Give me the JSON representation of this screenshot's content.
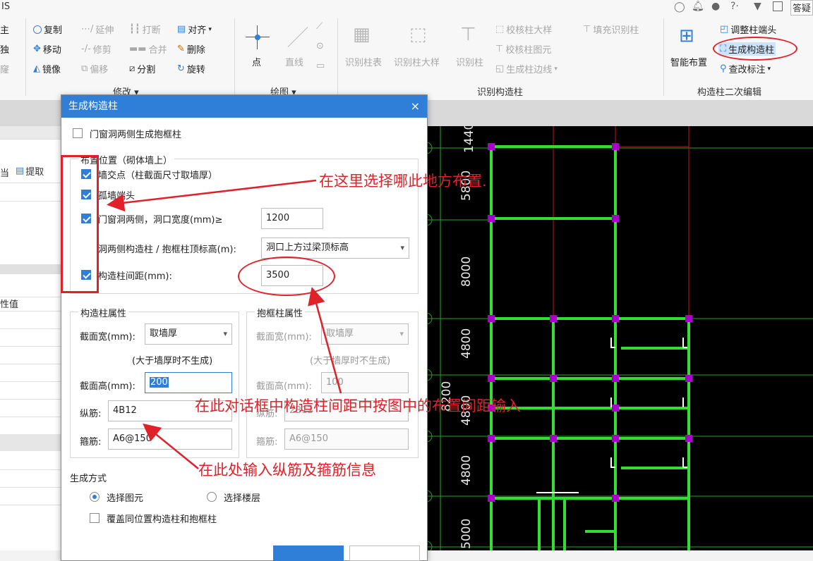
{
  "titlebar": {
    "left_fragment": "IS",
    "right_fragment": "答疑"
  },
  "ribbon": {
    "left_cut": [
      "主",
      "独",
      "窿"
    ],
    "modify": {
      "copy": "复制",
      "extend": "延伸",
      "break": "打断",
      "align": "对齐",
      "move": "移动",
      "trim": "修剪",
      "merge": "合并",
      "delete": "删除",
      "mirror": "镜像",
      "offset": "偏移",
      "split": "分割",
      "rotate": "旋转",
      "group": "修改 ▾"
    },
    "draw": {
      "point": "点",
      "line": "直线",
      "group": "绘图 ▾"
    },
    "recognize": {
      "col_table": "识别柱表",
      "col_sample": "识别柱大样",
      "col": "识别柱",
      "check_sample": "校核柱大样",
      "check_plan": "校核柱图元",
      "gen_edge": "生成柱边线",
      "fill_recognize": "填充识别柱",
      "group": "识别构造柱"
    },
    "edit2": {
      "smart_place": "智能布置",
      "adjust_end": "调整柱端头",
      "gen_construct": "生成构造柱",
      "modify_label": "查改标注",
      "group": "构造柱二次编辑"
    }
  },
  "leftpanel": {
    "extract": "提取",
    "cut": "当",
    "prop_value": "性值"
  },
  "dialog": {
    "title": "生成构造柱",
    "close": "×",
    "opening_frame": "门窗洞两侧生成抱框柱",
    "placement_legend": "布置位置（砌体墙上）",
    "opt_wall_cross": "墙交点（柱截面尺寸取墙厚）",
    "opt_isolated_end": "孤墙端头",
    "opt_opening_sides": "门窗洞两侧，洞口宽度(mm)≥",
    "opening_width": "1200",
    "top_elev_label": "洞两侧构造柱 / 抱框柱顶标高(m):",
    "top_elev_value": "洞口上方过梁顶标高",
    "opt_spacing": "构造柱间距(mm):",
    "spacing_value": "3500",
    "col_props": {
      "legend": "构造柱属性",
      "width_label": "截面宽(mm):",
      "width_value": "取墙厚",
      "note": "(大于墙厚时不生成)",
      "height_label": "截面高(mm):",
      "height_value": "200",
      "long_bar_label": "纵筋:",
      "long_bar_value": "4B12",
      "stirrup_label": "箍筋:",
      "stirrup_value": "A6@150"
    },
    "frame_props": {
      "legend": "抱框柱属性",
      "width_label": "截面宽(mm):",
      "width_value": "取墙厚",
      "note": "(大于墙厚时不生成)",
      "height_label": "截面高(mm):",
      "height_value": "100",
      "long_bar_label": "纵筋:",
      "long_bar_value": "2B12",
      "stirrup_label": "箍筋:",
      "stirrup_value": "A6@150"
    },
    "gen_mode": "生成方式",
    "radio_select_elem": "选择图元",
    "radio_select_floor": "选择楼层",
    "overwrite": "覆盖同位置构造柱和抱框柱"
  },
  "annotations": {
    "choose_place": "在这里选择哪此地方布置.",
    "spacing_hint": "在此对话框中构造柱间距中按图中的布置间距输入",
    "bar_hint": "在此处输入纵筋及箍筋信息"
  },
  "drawing": {
    "dims": [
      "1440",
      "5800",
      "8000",
      "4800",
      "8200",
      "4800",
      "4800",
      "5000"
    ]
  },
  "colors": {
    "accent": "#2f7fd8",
    "annotation": "#e0212a",
    "wall": "#33dd33",
    "column": "#aa00cc"
  }
}
